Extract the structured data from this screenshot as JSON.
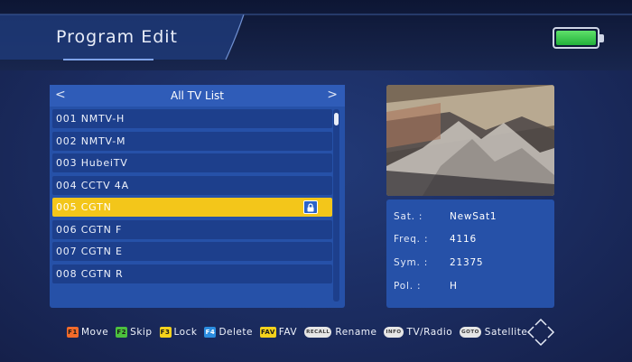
{
  "header": {
    "title": "Program Edit"
  },
  "channel_list": {
    "title": "All TV List",
    "prev_arrow": "<",
    "next_arrow": ">",
    "items": [
      {
        "label": "001 NMTV-H"
      },
      {
        "label": "002 NMTV-M"
      },
      {
        "label": "003 HubeiTV"
      },
      {
        "label": "004 CCTV 4A"
      },
      {
        "label": "005 CGTN",
        "selected": true,
        "locked": true
      },
      {
        "label": "006 CGTN F"
      },
      {
        "label": "007 CGTN E"
      },
      {
        "label": "008 CGTN R"
      }
    ]
  },
  "info": {
    "sat_label": "Sat. :",
    "sat_value": "NewSat1",
    "freq_label": "Freq. :",
    "freq_value": "4116",
    "sym_label": "Sym. :",
    "sym_value": "21375",
    "pol_label": "Pol. :",
    "pol_value": "H"
  },
  "footer": {
    "move_key": "F1",
    "move_label": "Move",
    "skip_key": "F2",
    "skip_label": "Skip",
    "lock_key": "F3",
    "lock_label": "Lock",
    "delete_key": "F4",
    "delete_label": "Delete",
    "fav_key": "FAV",
    "fav_label": "FAV",
    "rename_key": "RECALL",
    "rename_label": "Rename",
    "tvradio_key": "INFO",
    "tvradio_label": "TV/Radio",
    "satellite_key": "GOTO",
    "satellite_label": "Satellite"
  },
  "colors": {
    "selected_row": "#f3c61a",
    "battery": "#2fc040",
    "f1": "#f26b2a",
    "f2": "#4cc13e",
    "f3": "#f5d21c",
    "f4": "#2b8de0",
    "fav": "#f5d21c"
  },
  "icons": {
    "lock": "lock-icon",
    "battery": "battery-icon",
    "nav": "navigation-arrows-icon"
  }
}
